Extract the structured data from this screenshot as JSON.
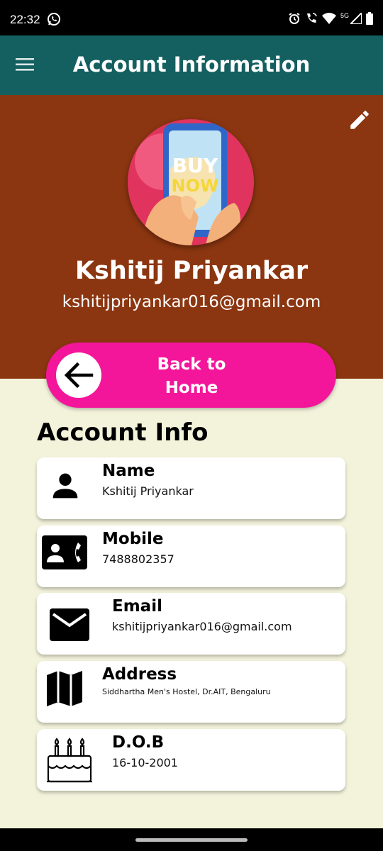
{
  "status_bar": {
    "time": "22:32",
    "network_label": "5G"
  },
  "app_bar": {
    "title": "Account Information"
  },
  "profile": {
    "name": "Kshitij Priyankar",
    "email": "kshitijpriyankar016@gmail.com",
    "avatar_text_line1": "BUY",
    "avatar_text_line2": "NOW"
  },
  "back_button": {
    "line1": "Back to",
    "line2": "Home"
  },
  "section": {
    "title": "Account Info"
  },
  "cards": [
    {
      "title": "Name",
      "value": "Kshitij Priyankar",
      "icon": "person-icon"
    },
    {
      "title": "Mobile",
      "value": "7488802357",
      "icon": "contact-phone-icon"
    },
    {
      "title": "Email",
      "value": "kshitijpriyankar016@gmail.com",
      "icon": "mail-icon"
    },
    {
      "title": "Address",
      "value": "Siddhartha Men's Hostel, Dr.AIT, Bengaluru",
      "icon": "map-icon"
    },
    {
      "title": "D.O.B",
      "value": "16-10-2001",
      "icon": "cake-icon"
    }
  ],
  "colors": {
    "app_bar": "#145f60",
    "header": "#8b3610",
    "button": "#f3169a",
    "panel": "#f3f3dc"
  }
}
